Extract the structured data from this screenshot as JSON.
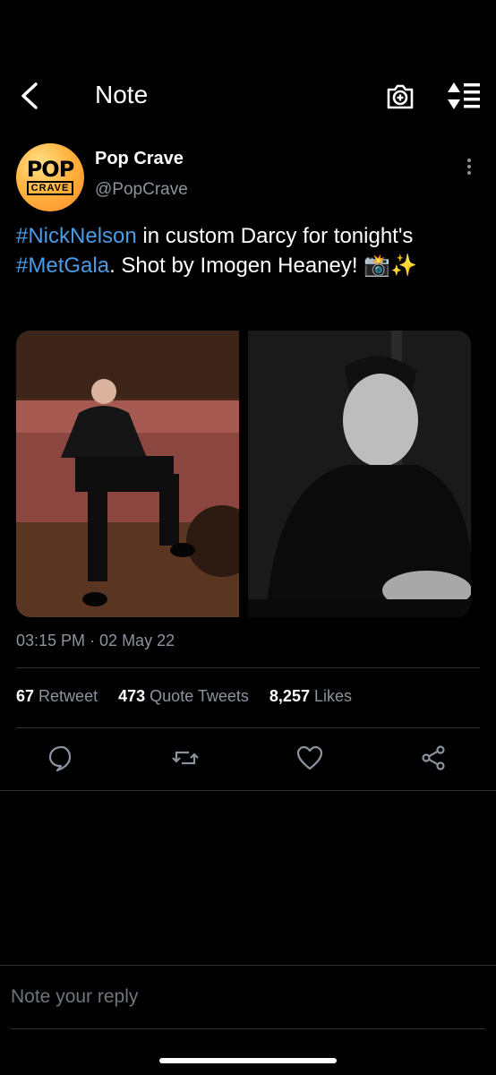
{
  "header": {
    "title": "Note"
  },
  "author": {
    "name": "Pop Crave",
    "handle": "@PopCrave",
    "logo_top": "POP",
    "logo_bottom": "CRAVE"
  },
  "tweet": {
    "tag1": "#NickNelson",
    "text1": " in custom Darcy for tonight's ",
    "tag2": "#MetGala",
    "text2": ". Shot by Imogen Heaney! 📸✨"
  },
  "meta": {
    "timestamp": "03:15 PM · 02 May 22"
  },
  "stats": {
    "retweets_count": "67",
    "retweets_label": "Retweet",
    "quotes_count": "473",
    "quotes_label": "Quote Tweets",
    "likes_count": "8,257",
    "likes_label": "Likes"
  },
  "reply": {
    "placeholder": "Note your reply"
  },
  "colors": {
    "accent": "#4a9be6",
    "secondary_text": "#8b949e",
    "background": "#000000"
  }
}
